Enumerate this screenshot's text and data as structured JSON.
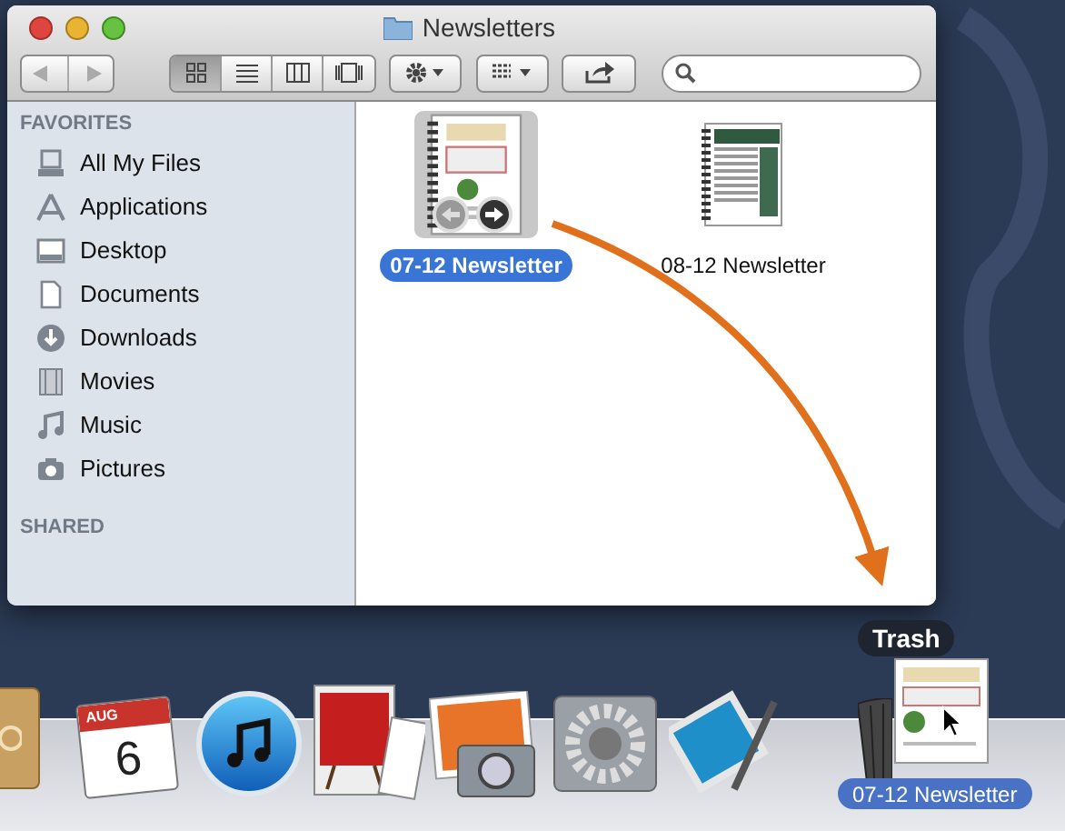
{
  "window": {
    "title": "Newsletters"
  },
  "toolbar": {
    "view_modes": [
      {
        "kind": "icons",
        "selected": true
      },
      {
        "kind": "list",
        "selected": false
      },
      {
        "kind": "columns",
        "selected": false
      },
      {
        "kind": "coverflow",
        "selected": false
      }
    ]
  },
  "sidebar": {
    "sections": [
      {
        "heading": "FAVORITES",
        "items": [
          {
            "label": "All My Files",
            "kind": "files"
          },
          {
            "label": "Applications",
            "kind": "apps"
          },
          {
            "label": "Desktop",
            "kind": "desktop"
          },
          {
            "label": "Documents",
            "kind": "documents"
          },
          {
            "label": "Downloads",
            "kind": "downloads"
          },
          {
            "label": "Movies",
            "kind": "movies"
          },
          {
            "label": "Music",
            "kind": "music"
          },
          {
            "label": "Pictures",
            "kind": "pictures"
          }
        ]
      },
      {
        "heading": "SHARED"
      }
    ]
  },
  "files": [
    {
      "name": "07-12 Newsletter",
      "selected": true
    },
    {
      "name": "08-12 Newsletter",
      "selected": false
    }
  ],
  "dock": {
    "calendar": {
      "month": "AUG",
      "day": "6"
    },
    "tooltip": "Trash",
    "drag_label": "07-12 Newsletter"
  }
}
